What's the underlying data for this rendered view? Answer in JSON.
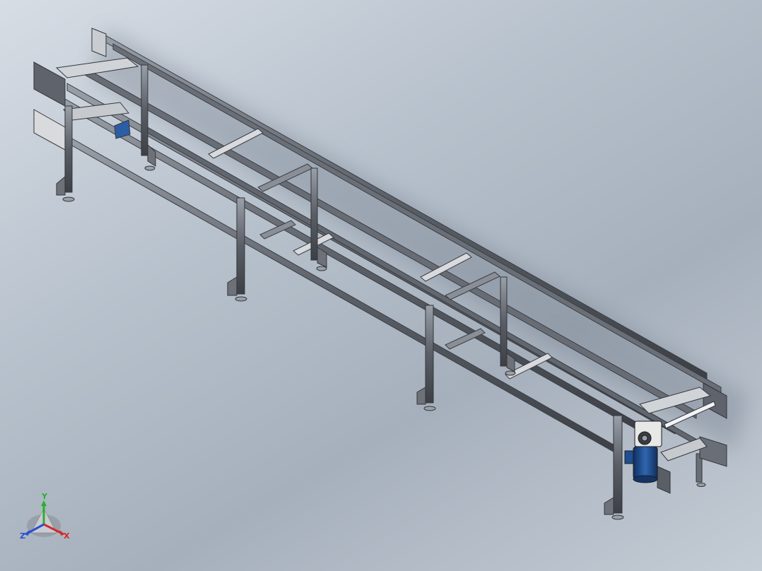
{
  "viewport": {
    "background_top": "#d7dde5",
    "background_bottom": "#a6b0bc"
  },
  "model": {
    "frame_color": "#5a5e66",
    "frame_highlight": "#9aa0a8",
    "roller_color": "#e4e6ea",
    "motor_color": "#1f4f8f",
    "gearbox_color": "#e8e8e6",
    "foot_color": "#6e7278",
    "label_plate_color": "#d9dadc"
  },
  "triad": {
    "x_label": "X",
    "y_label": "Y",
    "z_label": "Z",
    "x_color": "#d42a2a",
    "y_color": "#27b02d",
    "z_color": "#2a4fd4"
  }
}
